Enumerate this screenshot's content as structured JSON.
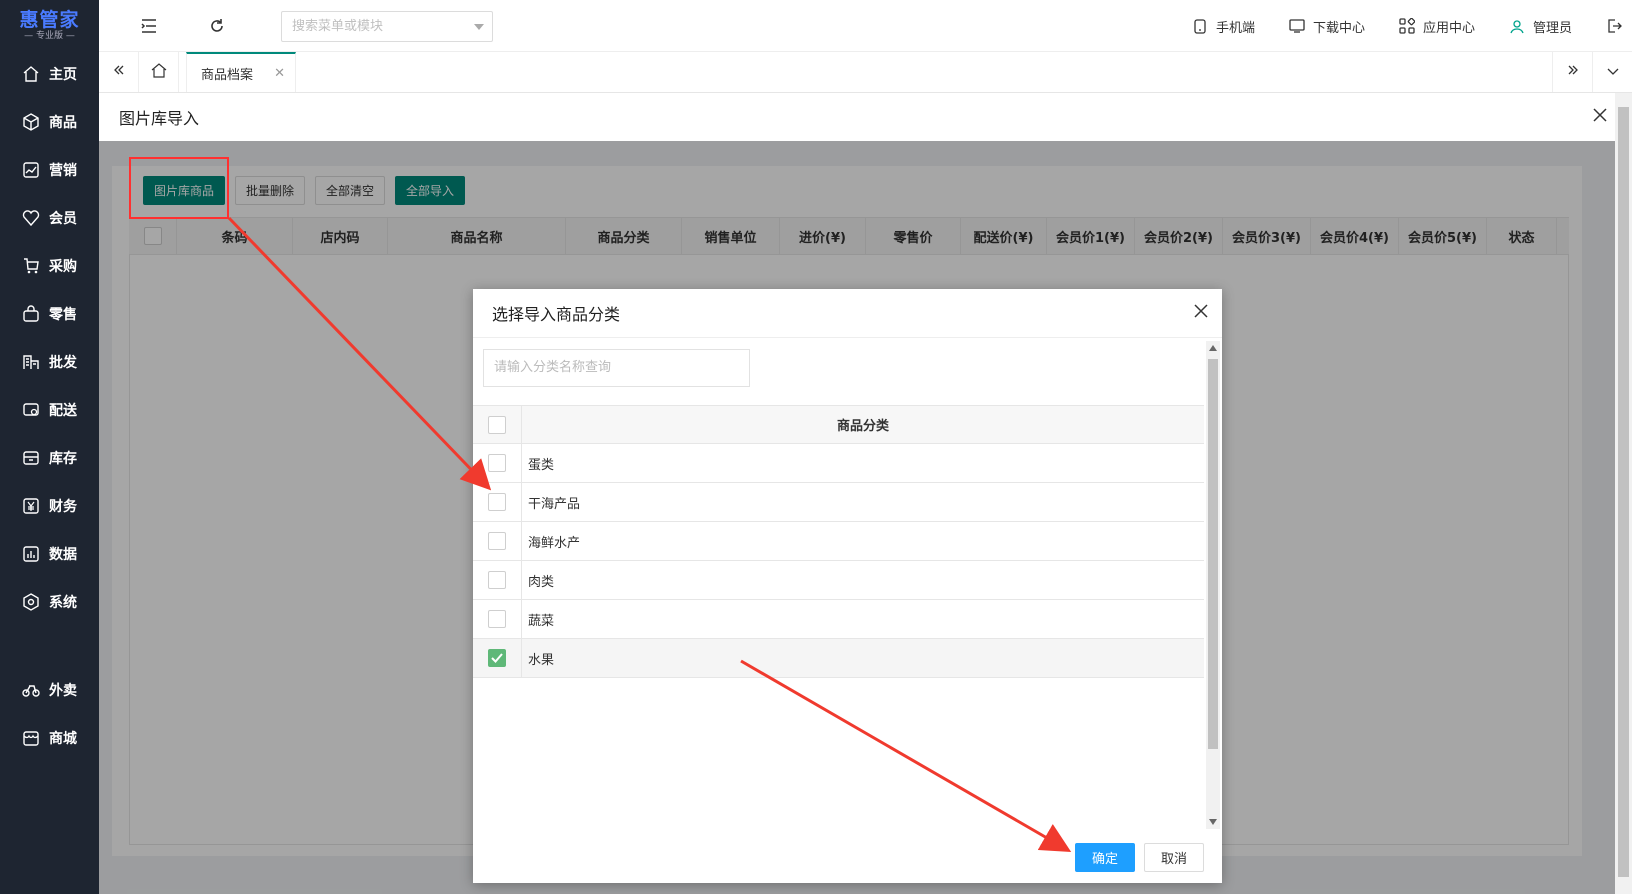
{
  "brand": {
    "name": "惠管家",
    "edition": "专业版"
  },
  "sidebar": {
    "items": [
      {
        "label": "主页",
        "icon": "home-icon"
      },
      {
        "label": "商品",
        "icon": "box-icon"
      },
      {
        "label": "营销",
        "icon": "chart-icon"
      },
      {
        "label": "会员",
        "icon": "heart-icon"
      },
      {
        "label": "采购",
        "icon": "cart-icon"
      },
      {
        "label": "零售",
        "icon": "bag-icon"
      },
      {
        "label": "批发",
        "icon": "building-icon"
      },
      {
        "label": "配送",
        "icon": "truck-icon"
      },
      {
        "label": "库存",
        "icon": "storage-icon"
      },
      {
        "label": "财务",
        "icon": "yen-icon"
      },
      {
        "label": "数据",
        "icon": "bar-chart-icon"
      },
      {
        "label": "系统",
        "icon": "settings-icon"
      }
    ],
    "extra_items": [
      {
        "label": "外卖",
        "icon": "bike-icon"
      },
      {
        "label": "商城",
        "icon": "store-icon"
      }
    ]
  },
  "topbar": {
    "search_placeholder": "搜索菜单或模块",
    "mobile": "手机端",
    "download": "下载中心",
    "apps": "应用中心",
    "user": "管理员"
  },
  "tabs": {
    "active": "商品档案"
  },
  "panel": {
    "title": "图片库导入"
  },
  "toolbar": {
    "gallery_goods": "图片库商品",
    "batch_delete": "批量删除",
    "clear_all": "全部清空",
    "import_all": "全部导入"
  },
  "grid": {
    "columns": [
      "条码",
      "店内码",
      "商品名称",
      "商品分类",
      "销售单位",
      "进价(¥)",
      "零售价",
      "配送价(¥)",
      "会员价1(¥)",
      "会员价2(¥)",
      "会员价3(¥)",
      "会员价4(¥)",
      "会员价5(¥)",
      "状态"
    ]
  },
  "dialog": {
    "title": "选择导入商品分类",
    "search_placeholder": "请输入分类名称查询",
    "column": "商品分类",
    "rows": [
      {
        "name": "蛋类",
        "checked": false
      },
      {
        "name": "干海产品",
        "checked": false
      },
      {
        "name": "海鲜水产",
        "checked": false
      },
      {
        "name": "肉类",
        "checked": false
      },
      {
        "name": "蔬菜",
        "checked": false
      },
      {
        "name": "水果",
        "checked": true
      }
    ],
    "ok": "确定",
    "cancel": "取消"
  }
}
